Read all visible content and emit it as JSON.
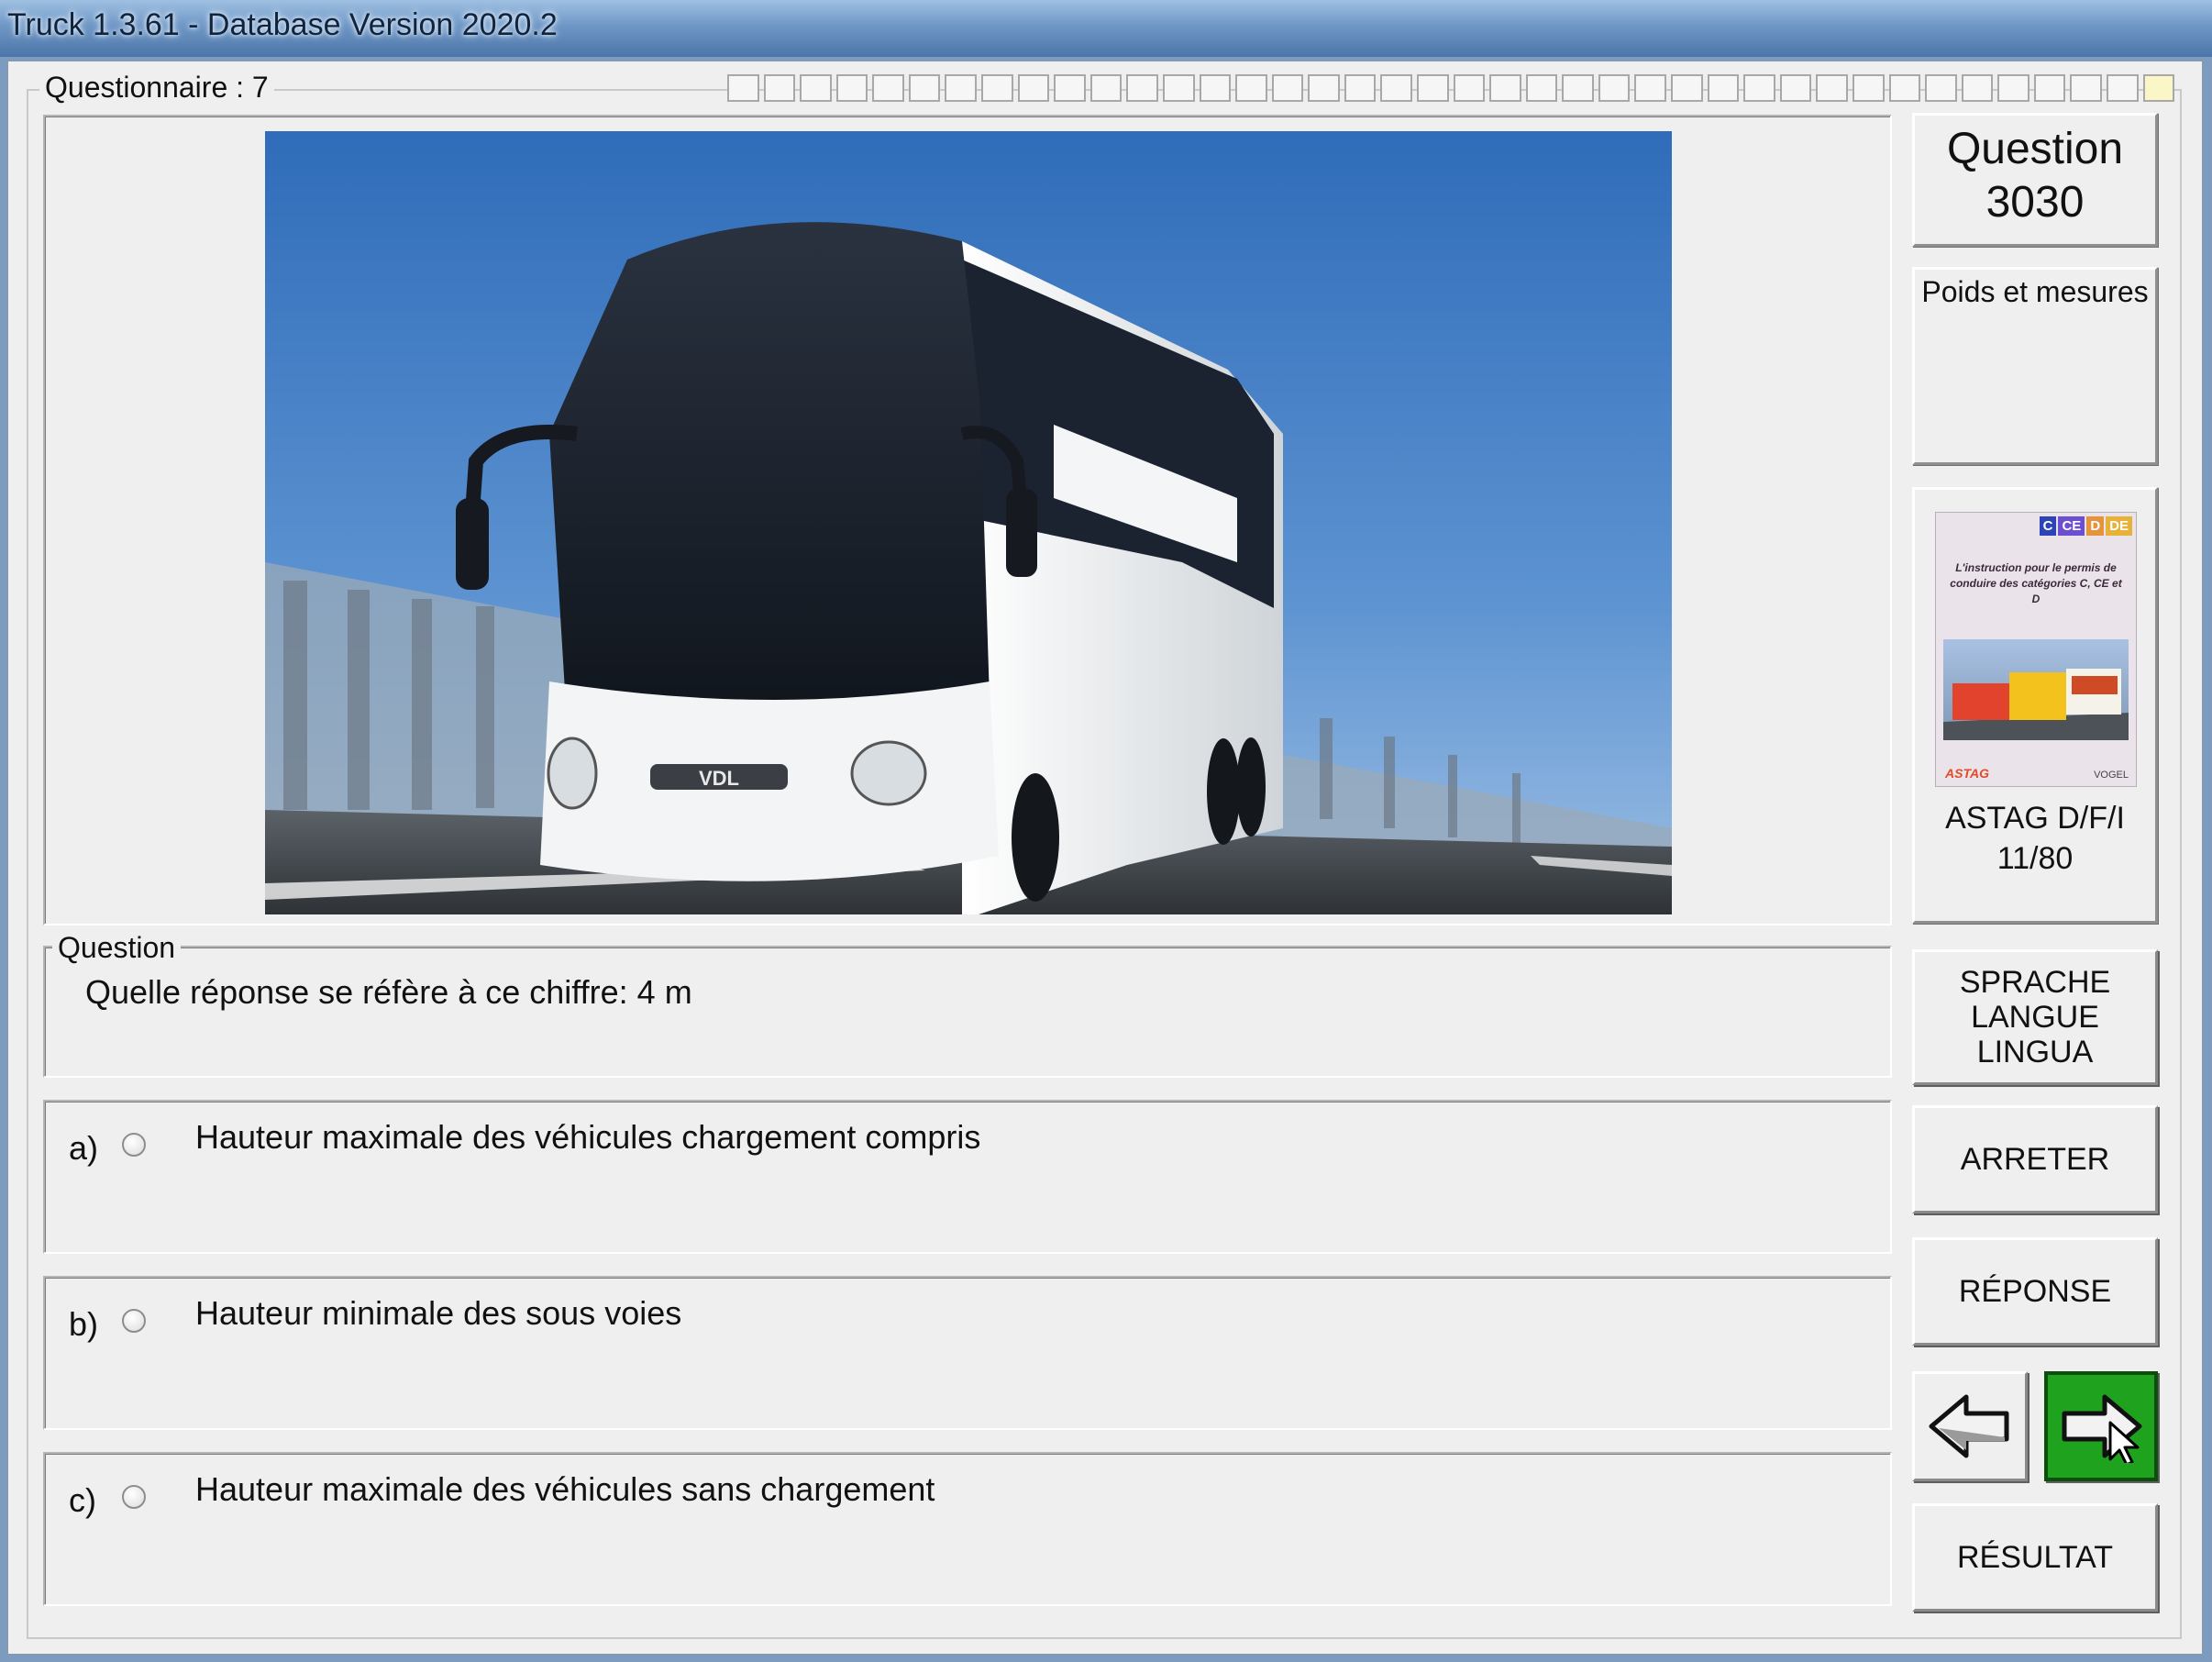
{
  "window": {
    "title": "Truck 1.3.61 - Database Version 2020.2"
  },
  "questionnaire": {
    "label": "Questionnaire : 7",
    "progress_total": 40,
    "progress_current": 40
  },
  "question_number": {
    "line1": "Question",
    "line2": "3030"
  },
  "category": "Poids et mesures",
  "book": {
    "badges": [
      "C",
      "CE",
      "D",
      "DE"
    ],
    "cover_text": "L'instruction pour le permis de conduire des catégories C, CE et D",
    "publisher_left": "ASTAG",
    "publisher_right": "VOGEL",
    "name": "ASTAG D/F/I",
    "page": "11/80"
  },
  "question": {
    "legend": "Question",
    "text": "Quelle réponse se réfère à ce chiffre: 4 m"
  },
  "answers": [
    {
      "letter": "a)",
      "text": "Hauteur maximale des véhicules chargement compris"
    },
    {
      "letter": "b)",
      "text": "Hauteur minimale des sous voies"
    },
    {
      "letter": "c)",
      "text": "Hauteur maximale des véhicules sans chargement"
    }
  ],
  "buttons": {
    "language": [
      "SPRACHE",
      "LANGUE",
      "LINGUA"
    ],
    "stop": "ARRETER",
    "answer": "RÉPONSE",
    "result": "RÉSULTAT"
  },
  "icons": {
    "back": "arrow-left-icon",
    "next": "arrow-right-cursor-icon"
  },
  "colors": {
    "next_button_bg": "#1fa31f",
    "sky": "#4a82c8",
    "bus_body": "#f1f2f2"
  },
  "photo": {
    "brand": "VDL"
  }
}
